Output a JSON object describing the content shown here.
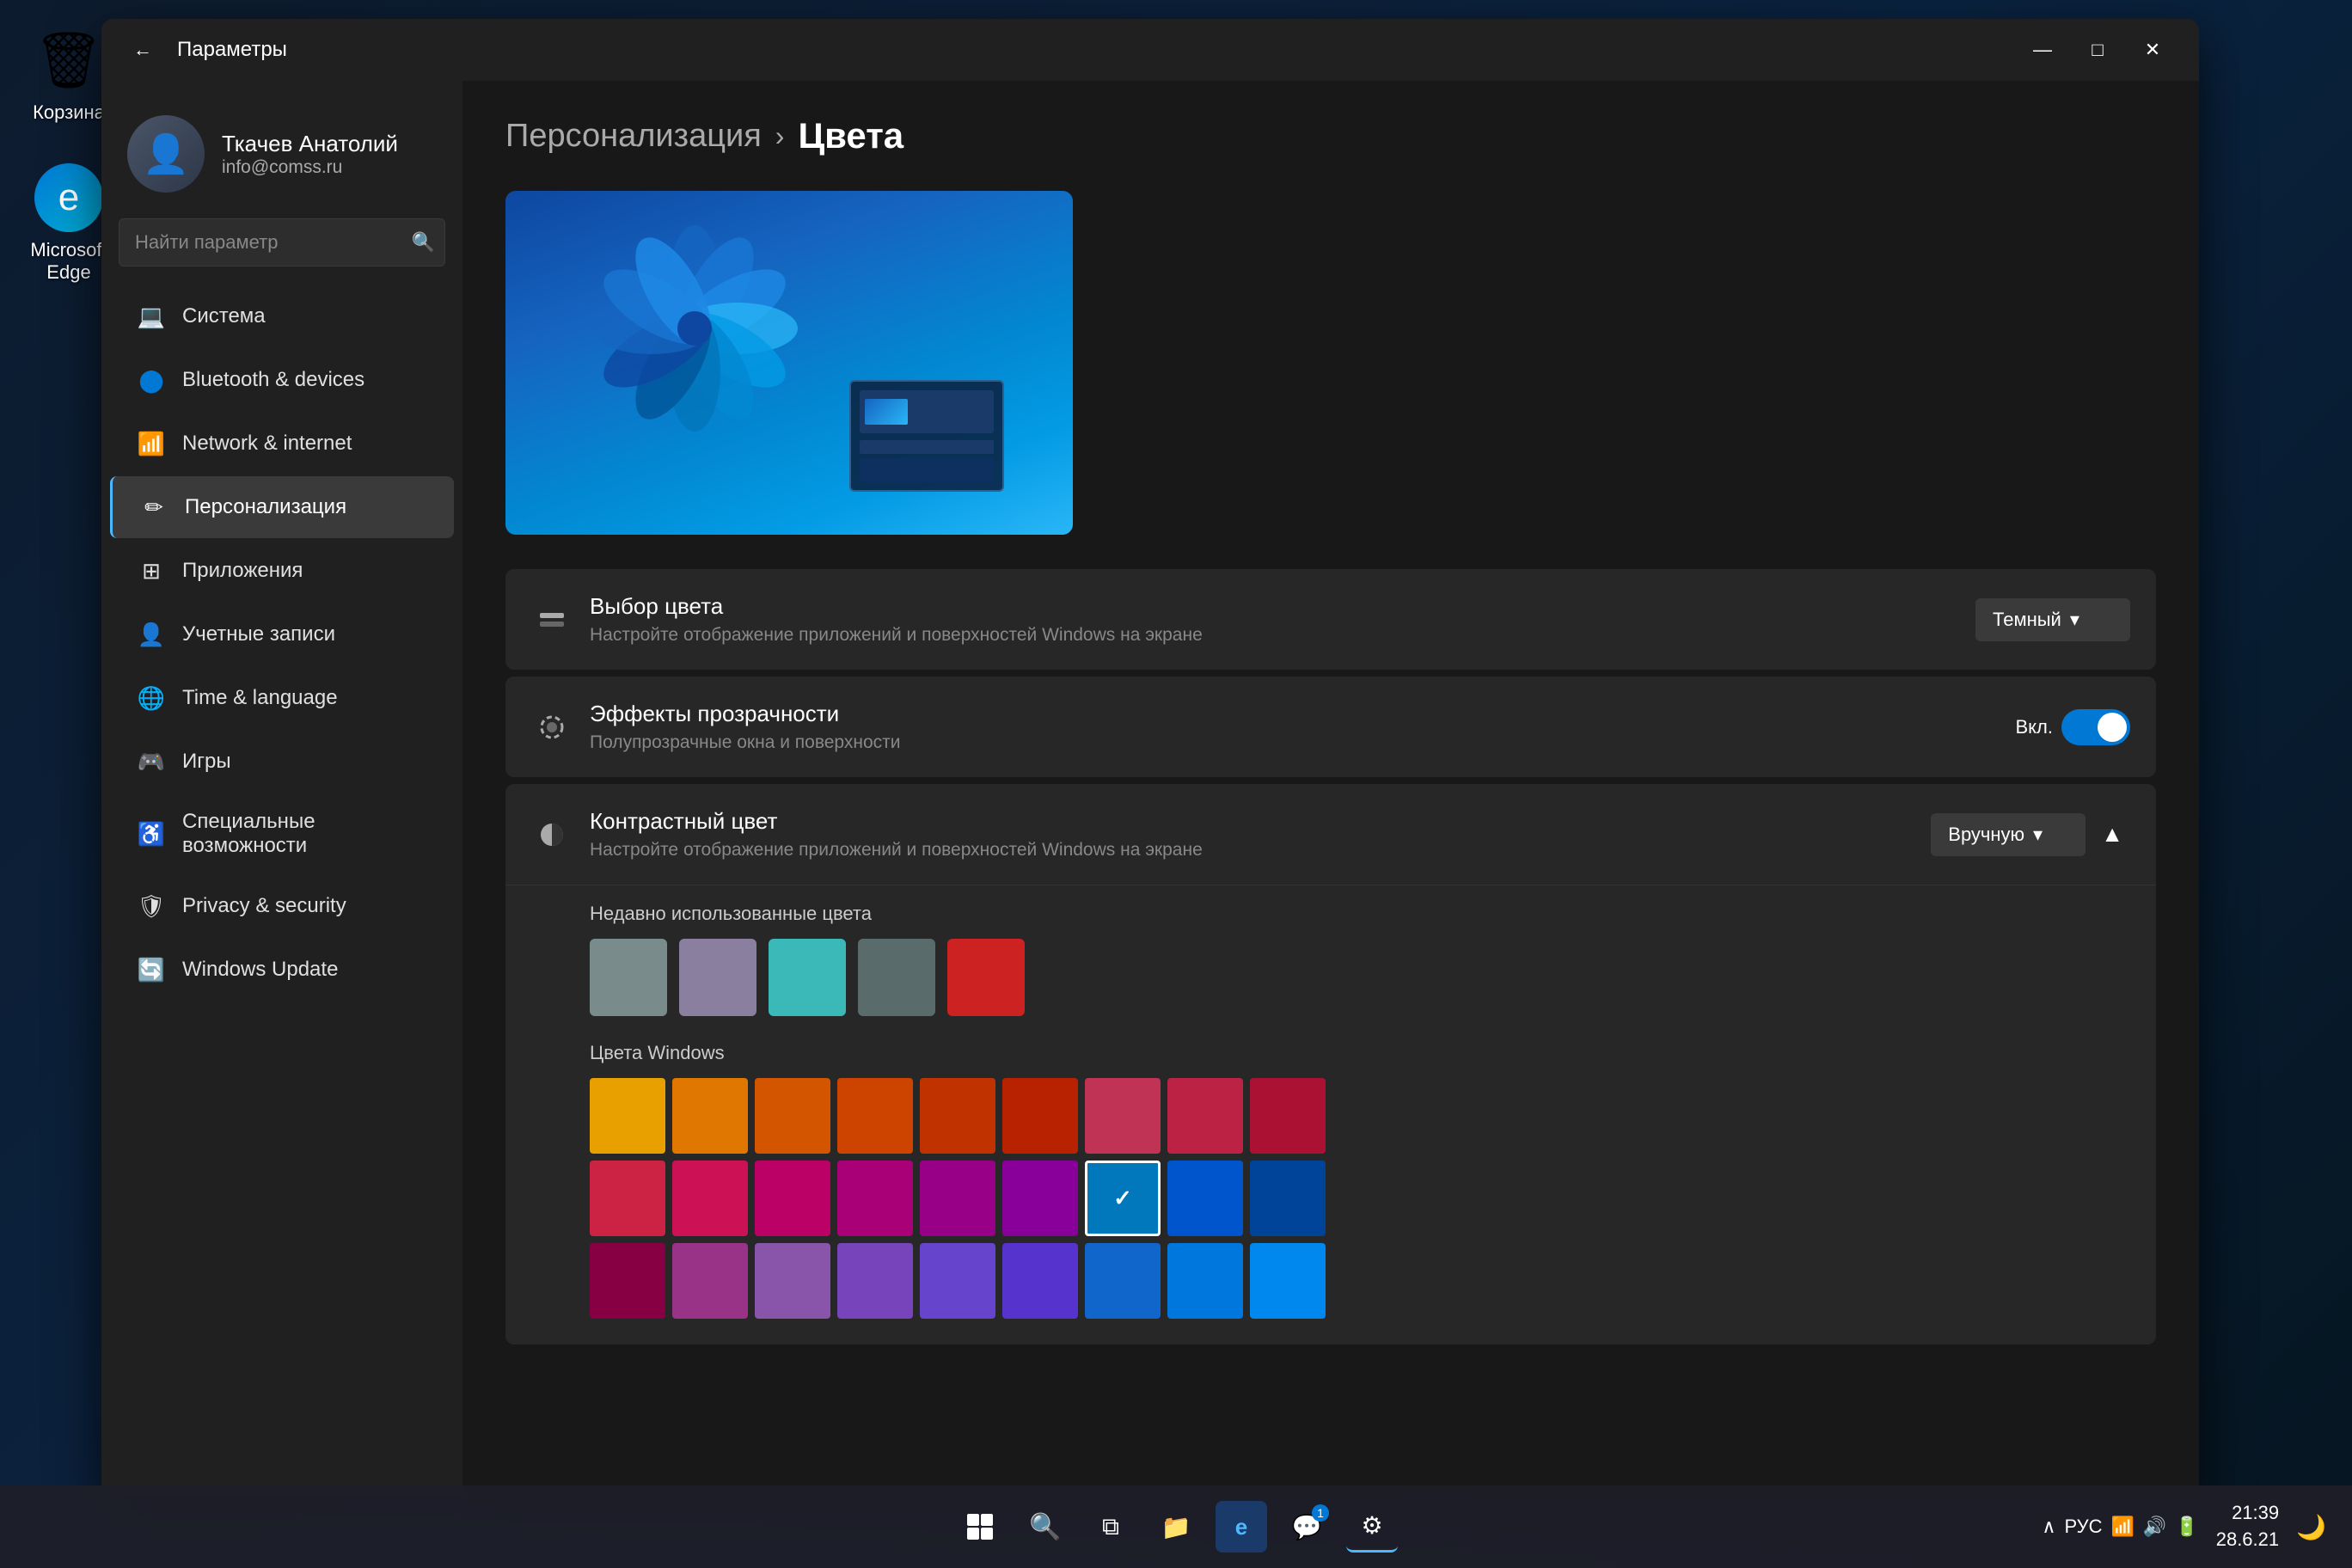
{
  "desktop": {
    "icons": [
      {
        "id": "recycle-bin",
        "label": "Корзина",
        "symbol": "🗑"
      },
      {
        "id": "edge",
        "label": "Microsoft Edge",
        "symbol": "⬡"
      }
    ]
  },
  "taskbar": {
    "start_symbol": "⊞",
    "search_symbol": "🔍",
    "apps": [
      "⊞",
      "🔍",
      "⊟",
      "📁",
      "🌐",
      "💬",
      "🛡"
    ],
    "clock_time": "21:39",
    "clock_date": "28.6.21",
    "lang": "РУС",
    "notifications_symbol": "🔔"
  },
  "window": {
    "title": "Параметры",
    "controls": {
      "minimize": "—",
      "maximize": "□",
      "close": "✕"
    }
  },
  "sidebar": {
    "user": {
      "name": "Ткачев Анатолий",
      "email": "info@comss.ru"
    },
    "search_placeholder": "Найти параметр",
    "nav_items": [
      {
        "id": "system",
        "label": "Система",
        "icon": "💻",
        "active": false
      },
      {
        "id": "bluetooth",
        "label": "Bluetooth & devices",
        "icon": "🔵",
        "active": false
      },
      {
        "id": "network",
        "label": "Network & internet",
        "icon": "📶",
        "active": false
      },
      {
        "id": "personalization",
        "label": "Персонализация",
        "icon": "✏",
        "active": true
      },
      {
        "id": "apps",
        "label": "Приложения",
        "icon": "🗔",
        "active": false
      },
      {
        "id": "accounts",
        "label": "Учетные записи",
        "icon": "👤",
        "active": false
      },
      {
        "id": "time",
        "label": "Time & language",
        "icon": "🌐",
        "active": false
      },
      {
        "id": "gaming",
        "label": "Игры",
        "icon": "🎮",
        "active": false
      },
      {
        "id": "accessibility",
        "label": "Специальные возможности",
        "icon": "♿",
        "active": false
      },
      {
        "id": "privacy",
        "label": "Privacy & security",
        "icon": "🛡",
        "active": false
      },
      {
        "id": "update",
        "label": "Windows Update",
        "icon": "🔄",
        "active": false
      }
    ]
  },
  "main": {
    "breadcrumb_parent": "Персонализация",
    "breadcrumb_separator": "›",
    "breadcrumb_current": "Цвета",
    "settings": [
      {
        "id": "color-choice",
        "icon": "🎨",
        "title": "Выбор цвета",
        "desc": "Настройте отображение приложений и поверхностей Windows на экране",
        "control_type": "dropdown",
        "control_value": "Темный"
      },
      {
        "id": "transparency",
        "icon": "⧉",
        "title": "Эффекты прозрачности",
        "desc": "Полупрозрачные окна и поверхности",
        "control_type": "toggle",
        "toggle_state": true,
        "toggle_label": "Вкл."
      },
      {
        "id": "contrast-color",
        "icon": "◑",
        "title": "Контрастный цвет",
        "desc": "Настройте отображение приложений и поверхностей Windows на экране",
        "control_type": "dropdown-expand",
        "control_value": "Вручную",
        "expanded": true
      }
    ],
    "recent_colors_label": "Недавно использованные цвета",
    "recent_colors": [
      "#7a8b8b",
      "#8b7fa0",
      "#3bb8b8",
      "#5a6b6b",
      "#cc2222"
    ],
    "windows_colors_label": "Цвета Windows",
    "windows_colors_row1": [
      "#e8a000",
      "#e07700",
      "#d45500",
      "#cc4400",
      "#c03300",
      "#b82200",
      "#c03355",
      "#bb2244",
      "#aa1133"
    ],
    "windows_colors_row2": [
      "#cc2244",
      "#cc1155",
      "#bb0066",
      "#aa0077",
      "#990088",
      "#880099",
      "#0078bb",
      "#0055cc",
      "#004499"
    ],
    "windows_colors_row3": [
      "#880044",
      "#993388",
      "#8855aa",
      "#7744bb",
      "#6644cc",
      "#5533cc",
      "#1166cc",
      "#0077dd",
      "#0088ee"
    ],
    "selected_color_index": "row2_col7",
    "partial_row3_visible": true
  }
}
